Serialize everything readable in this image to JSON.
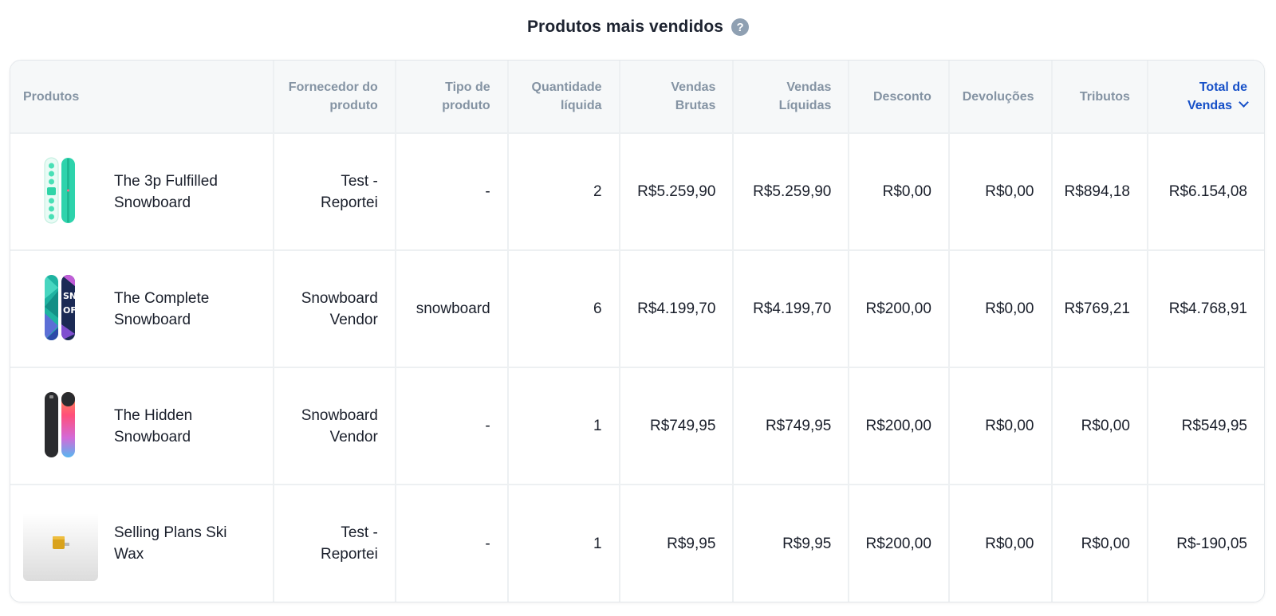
{
  "report": {
    "title": "Produtos mais vendidos",
    "help_icon": "question-circle-icon",
    "sort_icon": "chevron-down-icon"
  },
  "columns": [
    "Produtos",
    "Fornecedor do produto",
    "Tipo de produto",
    "Quantidade líquida",
    "Vendas Brutas",
    "Vendas Líquidas",
    "Desconto",
    "Devoluções",
    "Tributos",
    "Total de Vendas"
  ],
  "sorted_column": "Total de Vendas",
  "colors": {
    "accent": "#1650c8",
    "header_text": "#8493a3",
    "help_icon": "#8fa0b2"
  },
  "rows": [
    {
      "product": "The 3p Fulfilled Snowboard",
      "thumb": "snowboard-teal-image",
      "vendor": "Test - Reportei",
      "type": "-",
      "qty": "2",
      "gross": "R$5.259,90",
      "net": "R$5.259,90",
      "discount": "R$0,00",
      "returns": "R$0,00",
      "taxes": "R$894,18",
      "total": "R$6.154,08"
    },
    {
      "product": "The Complete Snowboard",
      "thumb": "snowboard-geometric-image",
      "vendor": "Snowboard Vendor",
      "type": "snowboard",
      "qty": "6",
      "gross": "R$4.199,70",
      "net": "R$4.199,70",
      "discount": "R$200,00",
      "returns": "R$0,00",
      "taxes": "R$769,21",
      "total": "R$4.768,91"
    },
    {
      "product": "The Hidden Snowboard",
      "thumb": "snowboard-black-gradient-image",
      "vendor": "Snowboard Vendor",
      "type": "-",
      "qty": "1",
      "gross": "R$749,95",
      "net": "R$749,95",
      "discount": "R$200,00",
      "returns": "R$0,00",
      "taxes": "R$0,00",
      "total": "R$549,95"
    },
    {
      "product": "Selling Plans Ski Wax",
      "thumb": "ski-wax-image",
      "vendor": "Test - Reportei",
      "type": "-",
      "qty": "1",
      "gross": "R$9,95",
      "net": "R$9,95",
      "discount": "R$200,00",
      "returns": "R$0,00",
      "taxes": "R$0,00",
      "total": "R$-190,05"
    }
  ]
}
